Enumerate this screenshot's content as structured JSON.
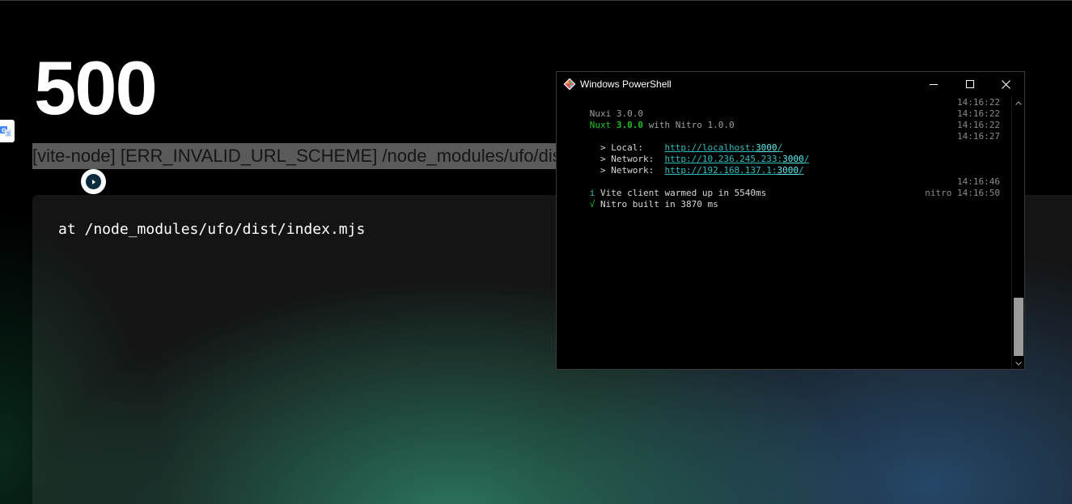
{
  "page": {
    "status_code": "500",
    "error_message": "[vite-node] [ERR_INVALID_URL_SCHEME] /node_modules/ufo/dist",
    "stack_line": "at /node_modules/ufo/dist/index.mjs"
  },
  "powershell": {
    "title": "Windows PowerShell",
    "lines": {
      "l1": {
        "text": "Nuxi 3.0.0",
        "time": "14:16:22"
      },
      "l2": {
        "prefix": "Nuxt ",
        "version": "3.0.0",
        "suffix": " with Nitro 1.0.0",
        "time": "14:16:22"
      },
      "l3": {
        "time": "14:16:22"
      },
      "l4": {
        "time": "14:16:27"
      },
      "local": {
        "label": "  > Local:    ",
        "url": "http://localhost:",
        "port": "3000",
        "tail": "/"
      },
      "net1": {
        "label": "  > Network:  ",
        "url": "http://10.236.245.233:",
        "port": "3000",
        "tail": "/"
      },
      "net2": {
        "label": "  > Network:  ",
        "url": "http://192.168.137.1:",
        "port": "3000",
        "tail": "/"
      },
      "vite": {
        "icon": "i",
        "text": " Vite client warmed up in 5540ms",
        "time": "14:16:46"
      },
      "nitro": {
        "icon": "√",
        "text": " Nitro built in 3870 ms",
        "tag": "nitro",
        "time": "14:16:50"
      }
    }
  },
  "icons": {
    "app": "powershell-app-icon",
    "minimize": "minimize-icon",
    "maximize": "maximize-icon",
    "close": "close-icon",
    "translate": "translate-icon",
    "badge": "extension-badge-icon"
  },
  "colors": {
    "nuxt_green": "#1fc21f",
    "link_cyan": "#2fbfbf",
    "selection_gray": "#6a6a6a"
  }
}
